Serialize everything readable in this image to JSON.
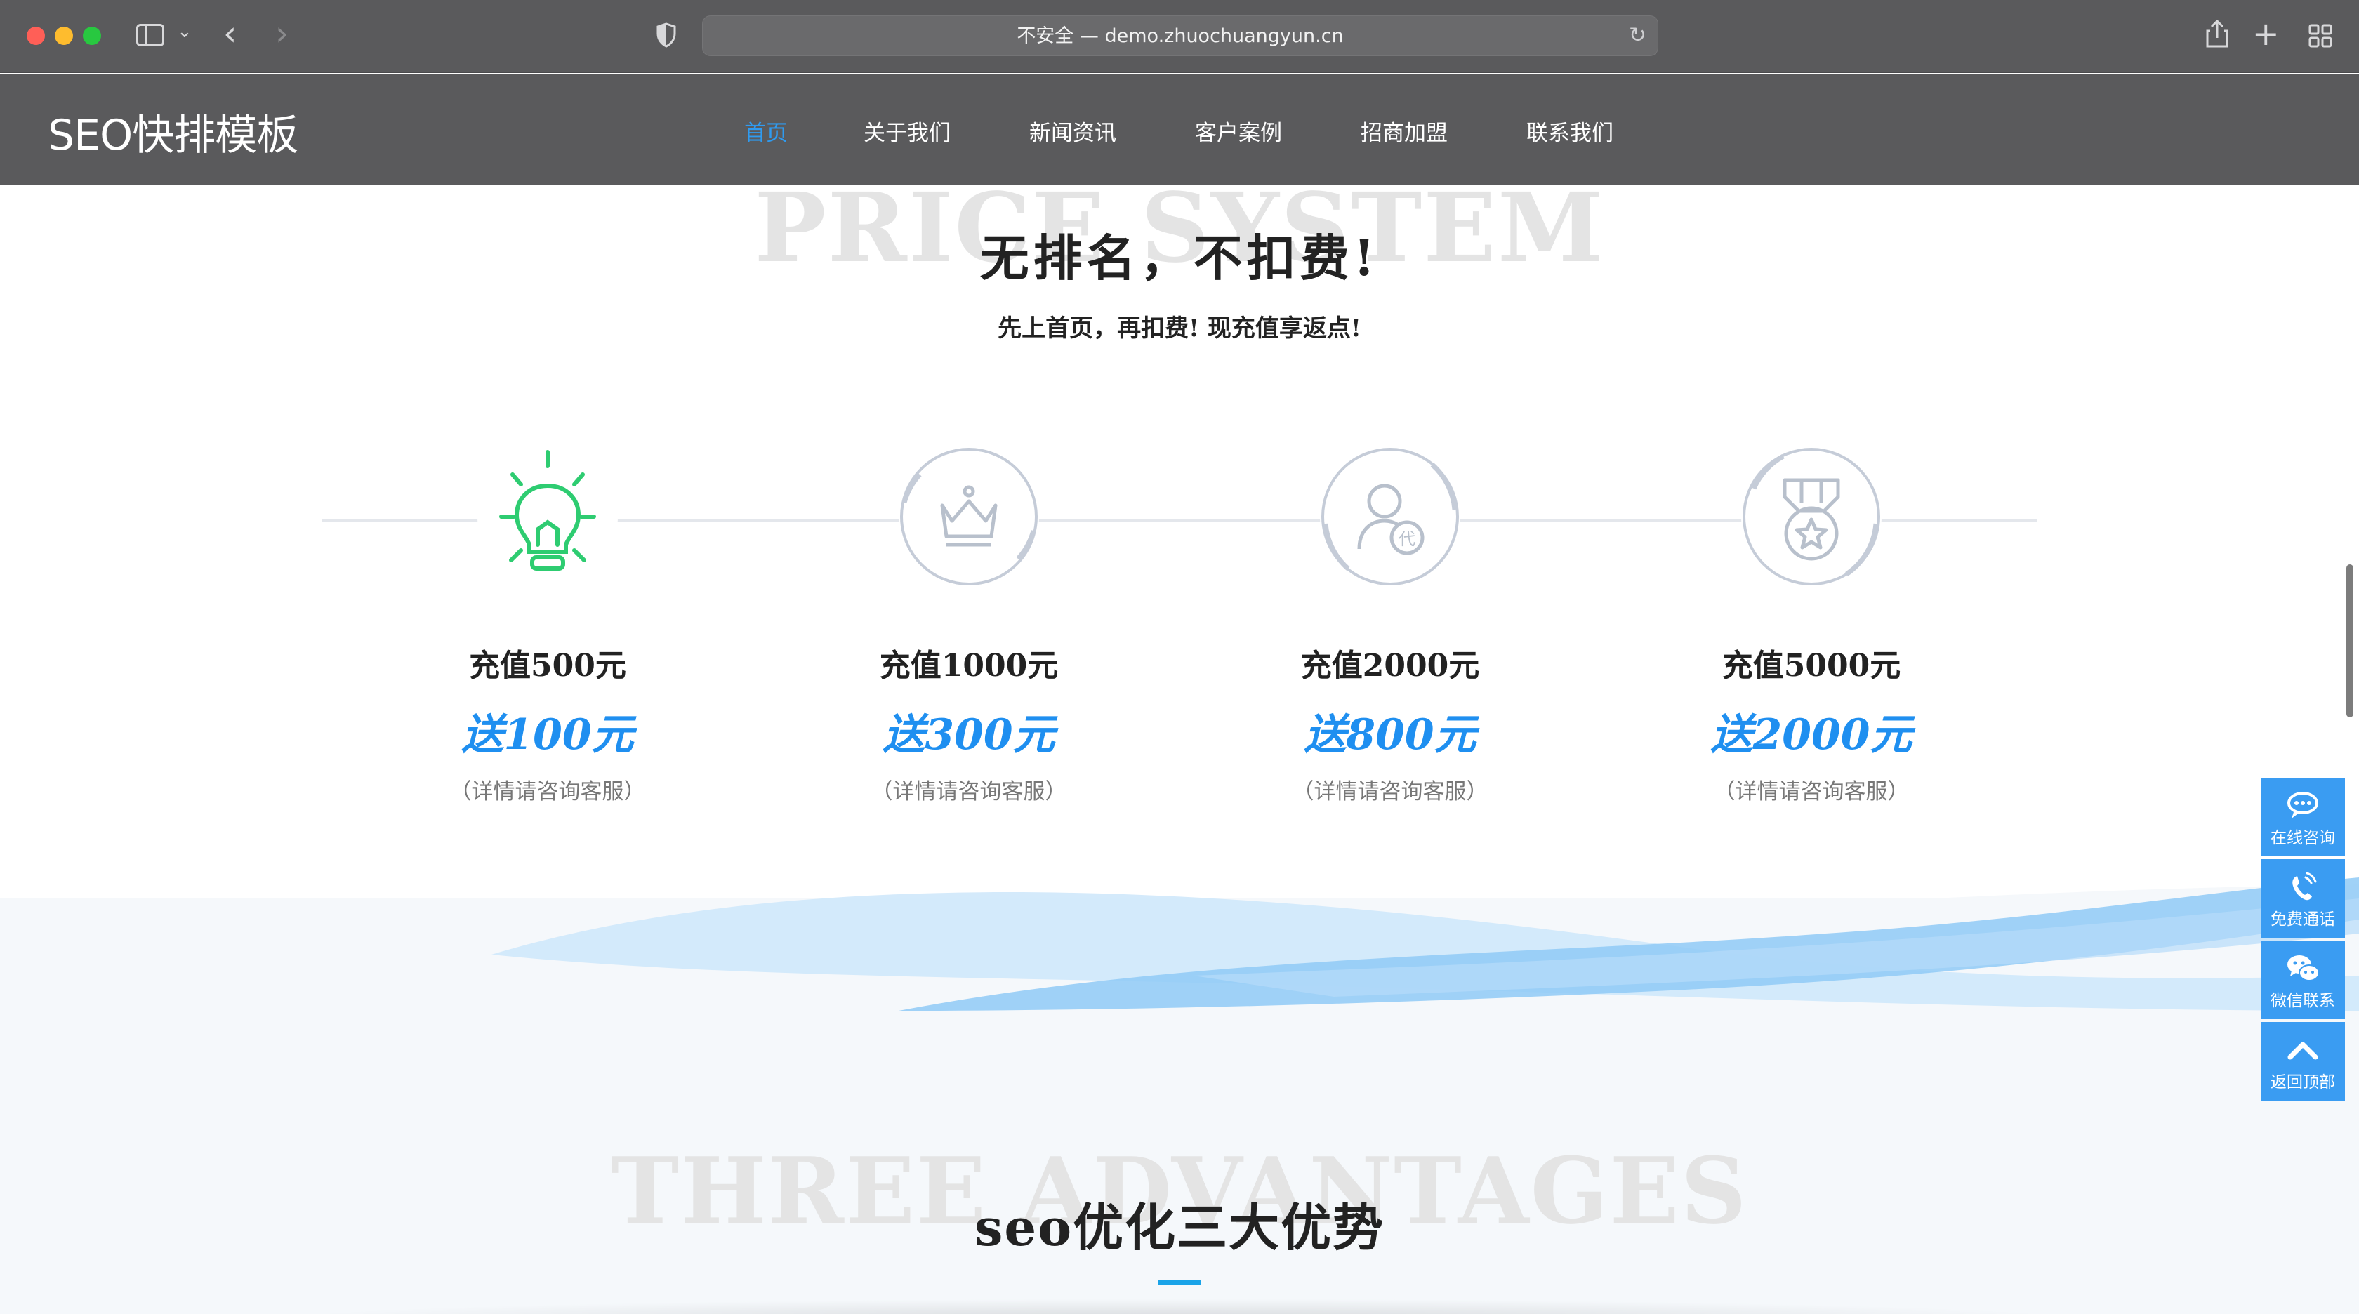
{
  "browser": {
    "url": "不安全 — demo.zhuochuangyun.cn",
    "icons": [
      "sidebar-icon",
      "chevron-down-icon",
      "back-icon",
      "forward-icon",
      "shield-icon",
      "reload-icon",
      "share-icon",
      "plus-icon",
      "tab-overview-icon"
    ],
    "back_glyph": "‹",
    "forward_glyph": "›",
    "chevron_glyph": "⌄",
    "reload_glyph": "↻",
    "newtab_glyph": "+"
  },
  "header": {
    "logo": "SEO快排模板",
    "nav": [
      {
        "label": "首页",
        "active": true
      },
      {
        "label": "关于我们"
      },
      {
        "label": "新闻资讯"
      },
      {
        "label": "客户案例"
      },
      {
        "label": "招商加盟"
      },
      {
        "label": "联系我们"
      }
    ]
  },
  "price": {
    "bg_title": "PRICE SYSTEM",
    "title": "无排名，不扣费!",
    "subtitle": "先上首页，再扣费! 现充值享返点!",
    "plans": [
      {
        "title": "充值500元",
        "bonus": "送100元",
        "note": "（详情请咨询客服）",
        "icon": "lightbulb-icon"
      },
      {
        "title": "充值1000元",
        "bonus": "送300元",
        "note": "（详情请咨询客服）",
        "icon": "crown-icon"
      },
      {
        "title": "充值2000元",
        "bonus": "送800元",
        "note": "（详情请咨询客服）",
        "icon": "agent-user-icon"
      },
      {
        "title": "充值5000元",
        "bonus": "送2000元",
        "note": "（详情请咨询客服）",
        "icon": "medal-star-icon"
      }
    ]
  },
  "advantages": {
    "bg_title": "THREE ADVANTAGES",
    "title": "seo优化三大优势"
  },
  "float_bar": [
    {
      "label": "在线咨询",
      "icon": "chat-icon"
    },
    {
      "label": "免费通话",
      "icon": "phone-icon"
    },
    {
      "label": "微信联系",
      "icon": "wechat-icon"
    },
    {
      "label": "返回顶部",
      "icon": "chevron-up-icon"
    }
  ],
  "colors": {
    "header_bg": "#5a5a5c",
    "accent_blue": "#1f8ff0",
    "nav_active": "#2f9bf0",
    "green_icon": "#2ecc71",
    "float_bg": "#3a9cf2"
  }
}
